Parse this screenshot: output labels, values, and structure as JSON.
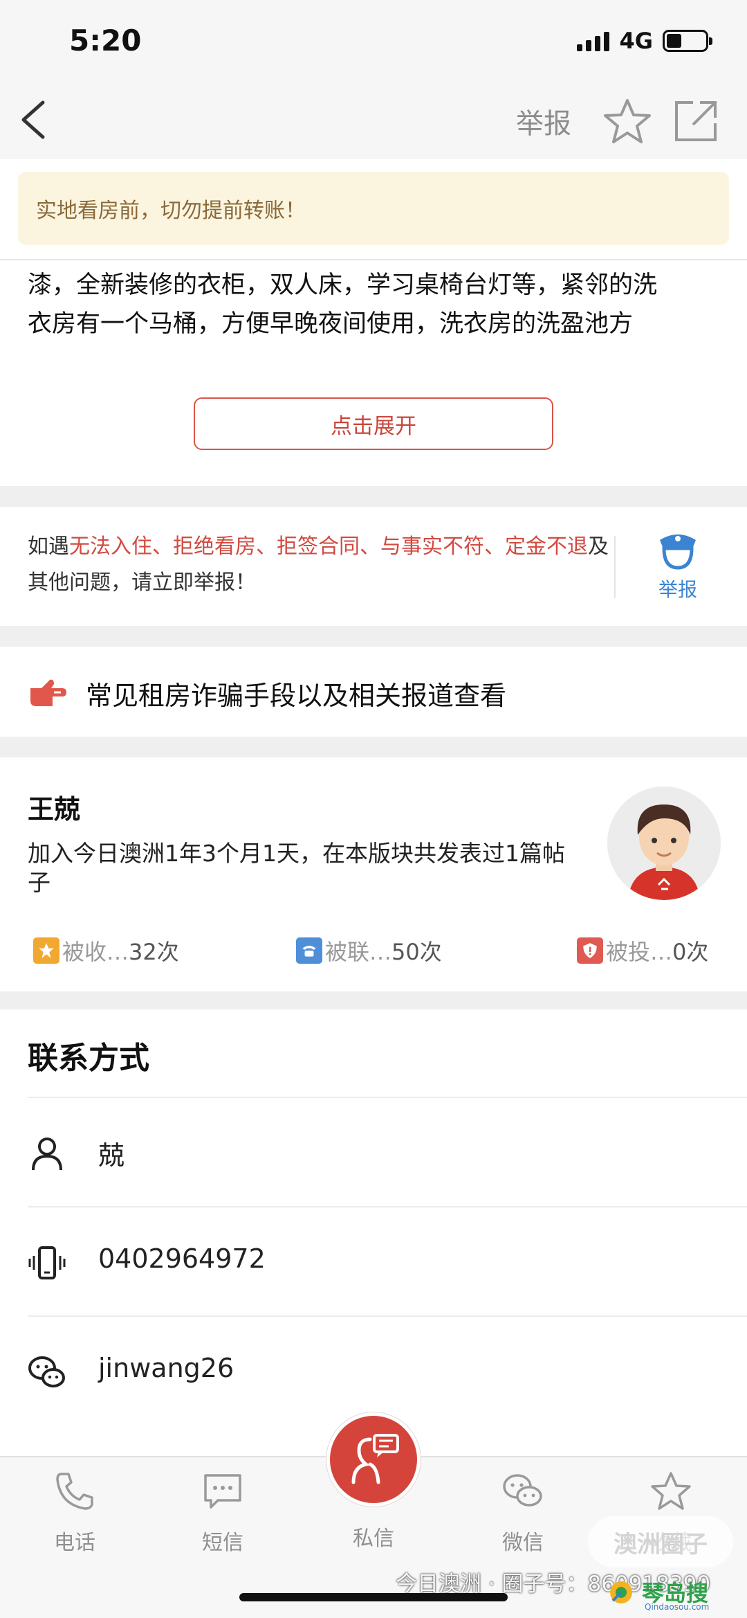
{
  "status": {
    "time": "5:20",
    "network": "4G"
  },
  "nav": {
    "report": "举报",
    "back_icon": "chevron-left-icon",
    "star_icon": "star-icon",
    "share_icon": "share-icon"
  },
  "warning": {
    "text": "实地看房前，切勿提前转账！"
  },
  "description": {
    "line1": "漆，全新装修的衣柜，双人床，学习桌椅台灯等，紧邻的洗",
    "line2": "衣房有一个马桶，方便早晚夜间使用，洗衣房的洗盈池方"
  },
  "expand_button": {
    "label": "点击展开"
  },
  "alert": {
    "prefix": "如遇",
    "highlight": "无法入住、拒绝看房、拒签合同、与事实不符、定金不退",
    "suffix": "及其他问题，请立即举报！",
    "report_label": "举报",
    "highlight_color": "#d24a40"
  },
  "scam_guide": {
    "text": "常见租房诈骗手段以及相关报道查看"
  },
  "profile": {
    "name": "王兢",
    "info": "加入今日澳洲1年3个月1天，在本版块共发表过1篇帖子",
    "avatar_icon": "avatar",
    "stats": [
      {
        "label": "被收…",
        "value": "32次",
        "icon": "star-badge-icon",
        "color": "#f0a830"
      },
      {
        "label": "被联…",
        "value": "50次",
        "icon": "phone-badge-icon",
        "color": "#4e8fd8"
      },
      {
        "label": "被投…",
        "value": "0次",
        "icon": "shield-badge-icon",
        "color": "#e05a52"
      }
    ]
  },
  "contact": {
    "title": "联系方式",
    "rows": [
      {
        "icon": "person-icon",
        "value": "兢"
      },
      {
        "icon": "mobile-icon",
        "value": "0402964972"
      },
      {
        "icon": "wechat-icon",
        "value": "jinwang26"
      }
    ]
  },
  "tabbar": {
    "phone": "电话",
    "sms": "短信",
    "message": "私信",
    "wechat": "微信",
    "favorite": "收藏"
  },
  "watermark": {
    "pill": "澳洲圈子",
    "line": "今日澳洲 · 圈子号：860918390",
    "logo_text": "琴岛搜",
    "logo_sub": "Qindaosou.com"
  }
}
